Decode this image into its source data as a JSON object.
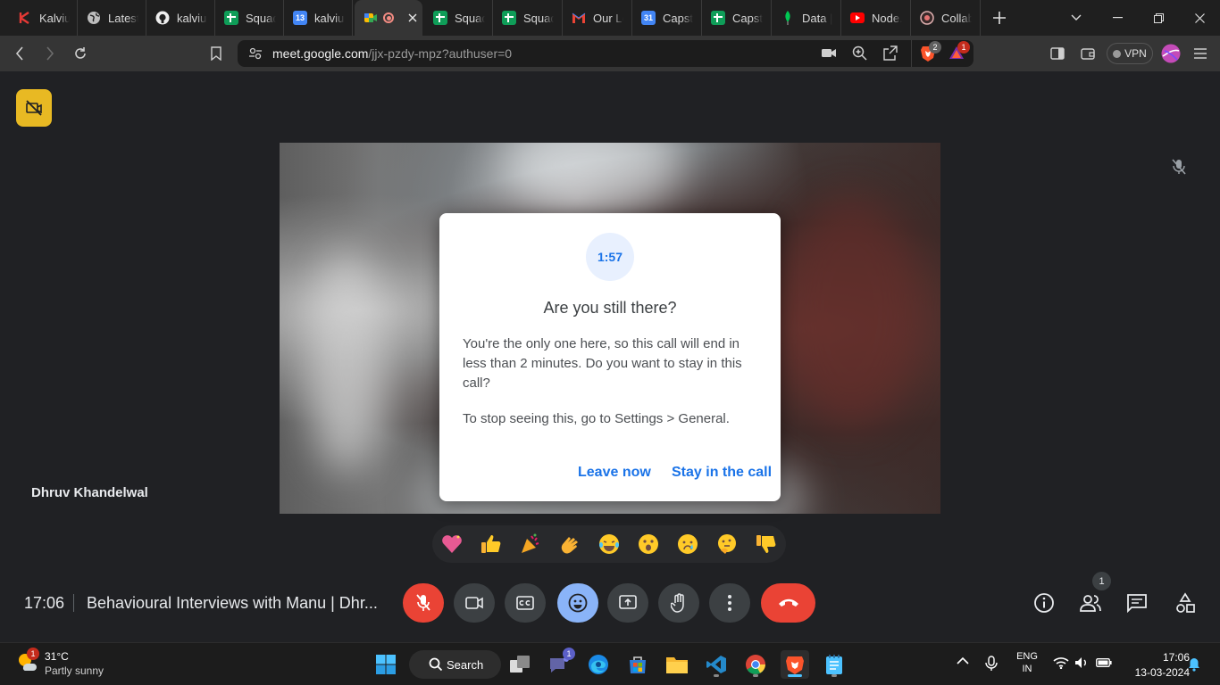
{
  "browser": {
    "tabs": [
      {
        "label": "Kalviu",
        "favicon_color": "#e53935"
      },
      {
        "label": "Latest",
        "favicon_color": "#9e9e9e"
      },
      {
        "label": "kalviu",
        "favicon_color": "#eeeeee"
      },
      {
        "label": "Squad",
        "favicon_color": "#0f9d58"
      },
      {
        "label": "kalviu",
        "favicon_color": "#4285f4"
      },
      {
        "label": "",
        "favicon_color": "#34a853",
        "active": true
      },
      {
        "label": "Squad",
        "favicon_color": "#0f9d58"
      },
      {
        "label": "Squad",
        "favicon_color": "#0f9d58"
      },
      {
        "label": "Our Le",
        "favicon_color": "#ea4335"
      },
      {
        "label": "Capsto",
        "favicon_color": "#4285f4"
      },
      {
        "label": "Capsto",
        "favicon_color": "#0f9d58"
      },
      {
        "label": "Data |",
        "favicon_color": "#00c853"
      },
      {
        "label": "Node.",
        "favicon_color": "#ff0000"
      },
      {
        "label": "Collab",
        "favicon_color": "#e0b0b0"
      }
    ],
    "calendar_favicon_day": "13",
    "calendar_favicon_day_2": "31",
    "url_host": "meet.google.com",
    "url_path": "/jjx-pzdy-mpz?authuser=0",
    "brave_shield_count": "2",
    "rewards_count": "1",
    "vpn_label": "VPN"
  },
  "meet": {
    "participant_name": "Dhruv Khandelwal",
    "dialog": {
      "timer": "1:57",
      "title": "Are you still there?",
      "body": "You're the only one here, so this call will end in less than 2 minutes. Do you want to stay in this call?",
      "note": "To stop seeing this, go to Settings > General.",
      "leave_label": "Leave now",
      "stay_label": "Stay in the call"
    },
    "reactions": [
      "💖",
      "👍",
      "🎉",
      "👏",
      "😂",
      "😮",
      "😢",
      "🤔",
      "👎"
    ],
    "clock": "17:06",
    "meeting_title": "Behavioural Interviews with Manu | Dhr...",
    "people_count": "1",
    "colors": {
      "mic_off_bg": "#ea4335",
      "end_call_bg": "#ea4335",
      "emoji_active_bg": "#8ab4f8",
      "camera_off_badge": "#e8b923",
      "dialog_link": "#1a73e8"
    }
  },
  "taskbar": {
    "weather_temp": "31°C",
    "weather_desc": "Partly sunny",
    "weather_badge": "1",
    "search_label": "Search",
    "teams_badge": "1",
    "lang_line1": "ENG",
    "lang_line2": "IN",
    "time": "17:06",
    "date": "13-03-2024"
  }
}
